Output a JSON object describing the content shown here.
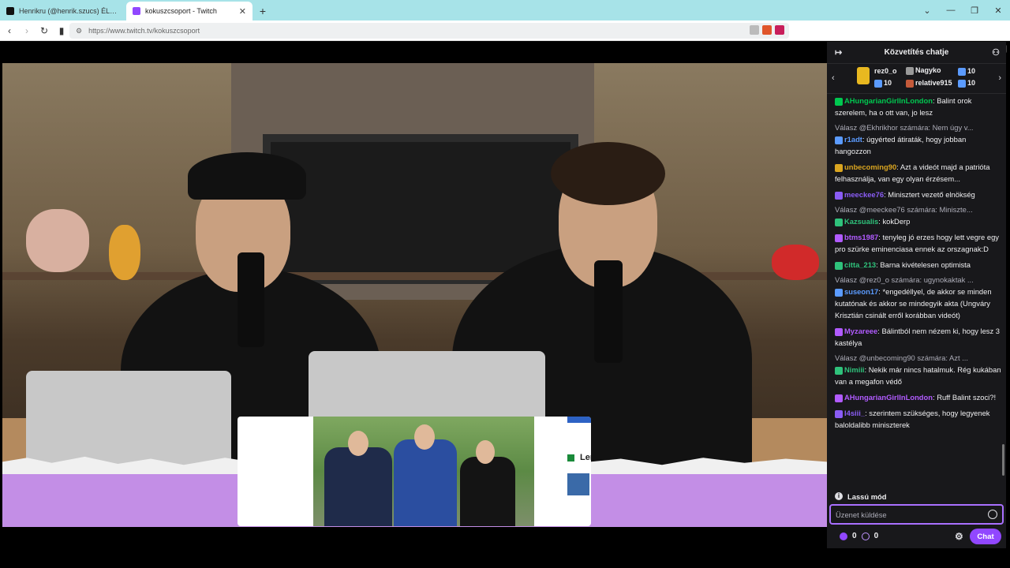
{
  "browser": {
    "tabs": [
      {
        "title": "Henrikru (@henrik.szucs) ÉLŐ adásb",
        "active": false
      },
      {
        "title": "kokuszcsoport - Twitch",
        "active": true
      }
    ],
    "new_tab": "+",
    "url": "https://www.twitch.tv/kokuszcsoport"
  },
  "video": {
    "overlay_text": "Ler"
  },
  "chat": {
    "title": "Közvetítés chatje",
    "leaderboard": [
      {
        "name": "rez0_o",
        "count": "10"
      },
      {
        "name": "Nagyko",
        "count": "10"
      },
      {
        "name": "",
        "count": "10"
      },
      {
        "name": "relative915",
        "count": "10"
      }
    ],
    "messages": [
      {
        "type": "msg",
        "user": "AHungarianGirlInLondon",
        "color": "#00c850",
        "text": "Balint orok szerelem, ha o ott van, jo lesz"
      },
      {
        "type": "reply",
        "text": "Válasz @Ekhrikhor számára: Nem úgy v..."
      },
      {
        "type": "msg",
        "user": "r1adt",
        "color": "#5b9bff",
        "text": "úgyérted átiraták, hogy jobban hangozzon"
      },
      {
        "type": "msg",
        "user": "unbecoming90",
        "color": "#daa520",
        "text": "Azt a videót majd a patrióta felhasználja, van egy olyan érzésem..."
      },
      {
        "type": "msg",
        "user": "meeckee76",
        "color": "#8a5cf5",
        "text": "Minisztert vezető elnökség"
      },
      {
        "type": "reply",
        "text": "Válasz @meeckee76 számára: Miniszte..."
      },
      {
        "type": "msg",
        "user": "Kazsualis",
        "color": "#2fc27b",
        "text": "kokDerp"
      },
      {
        "type": "msg",
        "user": "btms1987",
        "color": "#b15bff",
        "text": "tenyleg jó erzes hogy lett vegre egy pro szürke eminenciasa ennek az orszagnak:D"
      },
      {
        "type": "msg",
        "user": "citta_213",
        "color": "#2fc27b",
        "text": "Barna kivételesen optimista"
      },
      {
        "type": "reply",
        "text": "Válasz @rez0_o számára: ugynokaktak ..."
      },
      {
        "type": "msg",
        "user": "suseon17",
        "color": "#5b9bff",
        "text": "*engedéllyel, de akkor se minden kutatónak és akkor se mindegyik akta (Ungváry Krisztián csinált erről korábban videót)"
      },
      {
        "type": "msg",
        "user": "Myzareee",
        "color": "#b15bff",
        "text": "Bálintból nem nézem ki, hogy lesz 3 kastélya"
      },
      {
        "type": "reply",
        "text": "Válasz @unbecoming90 számára: Azt ..."
      },
      {
        "type": "msg",
        "user": "Nimiii",
        "color": "#2fc27b",
        "text": "Nekik már nincs hatalmuk. Rég kukában van a megafon védő"
      },
      {
        "type": "msg",
        "user": "AHungarianGirlInLondon",
        "color": "#b15bff",
        "text": "Ruff Balint szoci?!"
      },
      {
        "type": "msg",
        "user": "l4siii_",
        "color": "#8a5cf5",
        "text": "szerintem szükséges, hogy legyenek baloldalibb miniszterek"
      }
    ],
    "slow_mode": "Lassú mód",
    "input_placeholder": "Üzenet küldése",
    "points": "0",
    "points2": "0",
    "send_label": "Chat"
  }
}
